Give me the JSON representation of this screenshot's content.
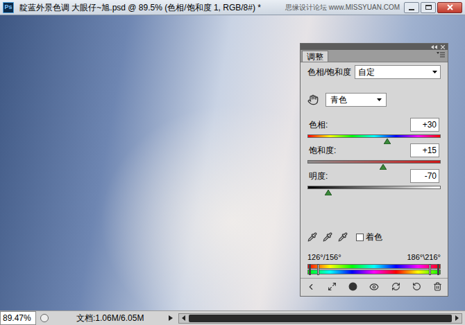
{
  "window": {
    "app_icon": "Ps",
    "title": "靛蓝外景色调 大眼仔~旭.psd @ 89.5% (色相/饱和度 1, RGB/8#) *",
    "watermark": "思缘设计论坛 www.MISSYUAN.COM"
  },
  "adjustments_panel": {
    "tab": "调整",
    "preset_label": "色相/饱和度",
    "preset": "自定",
    "channel": "青色",
    "sliders": [
      {
        "label": "色相:",
        "value": "+30",
        "level": 0.6,
        "kind": "hue"
      },
      {
        "label": "饱和度:",
        "value": "+15",
        "level": 0.57,
        "kind": "saturation"
      },
      {
        "label": "明度:",
        "value": "-70",
        "level": 0.15,
        "kind": "lightness"
      }
    ],
    "colorize": {
      "label": "着色",
      "checked": false
    },
    "range": {
      "left": "126°/156°",
      "right": "186°\\216°"
    }
  },
  "status_bar": {
    "zoom": "89.47%",
    "document": "文档:1.06M/6.05M"
  }
}
